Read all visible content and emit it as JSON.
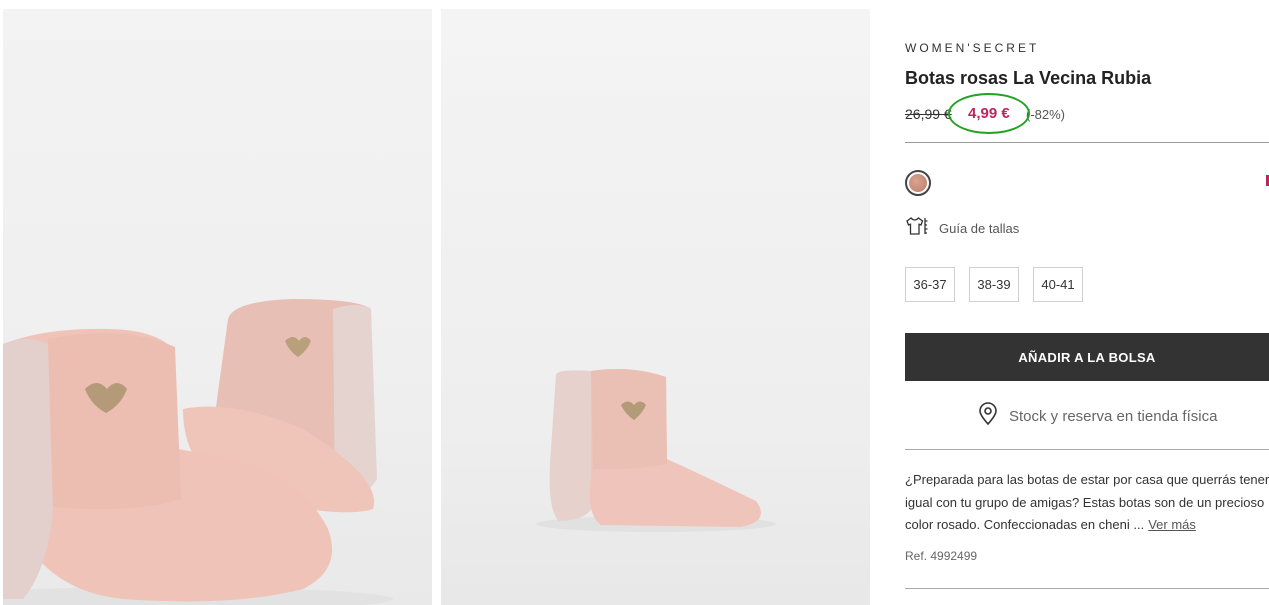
{
  "product": {
    "brand": "WOMEN'SECRET",
    "title": "Botas rosas La Vecina Rubia",
    "old_price": "26,99 €",
    "price": "4,99 €",
    "discount": "(-82%)",
    "swatch_color": "#c99282",
    "price_color": "#c0245c",
    "size_guide_label": "Guía de tallas",
    "size_guide_icon": "shirt-ruler-icon",
    "sizes": [
      "36-37",
      "38-39",
      "40-41"
    ],
    "add_to_bag_label": "AÑADIR A LA BOLSA",
    "stock_icon": "location-pin-icon",
    "stock_label": "Stock y reserva en tienda física",
    "description_lines": [
      "¿Preparada para las botas de estar por casa que querrás tener",
      "igual con tu grupo de amigas? Estas botas son de un precioso",
      "color rosado. Confeccionadas en cheni ..."
    ],
    "see_more_label": "Ver más",
    "reference": "Ref. 4992499"
  },
  "annotation": {
    "highlight_color": "#21a321"
  }
}
